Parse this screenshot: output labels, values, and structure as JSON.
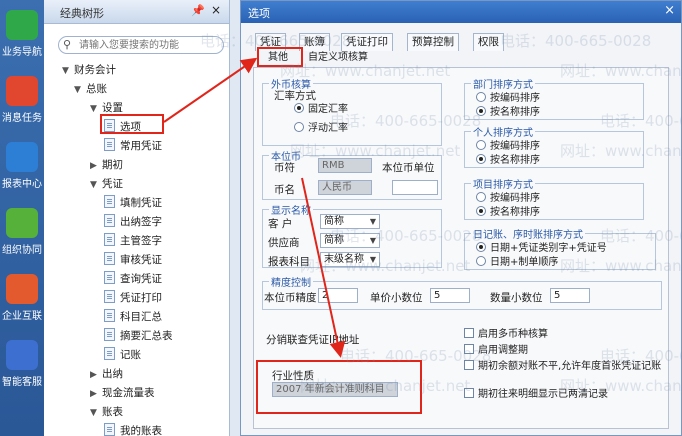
{
  "rail": [
    {
      "label": "业务导航",
      "icon": "business-nav-icon",
      "color": "#2fa84a"
    },
    {
      "label": "消息任务",
      "icon": "message-task-icon",
      "color": "#e1462f"
    },
    {
      "label": "报表中心",
      "icon": "report-center-icon",
      "color": "#2d7fd6"
    },
    {
      "label": "组织协同",
      "icon": "org-collab-icon",
      "color": "#55b13a"
    },
    {
      "label": "企业互联",
      "icon": "enterprise-link-icon",
      "color": "#e35a2e"
    },
    {
      "label": "智能客服",
      "icon": "smart-service-icon",
      "color": "#3d6fd1"
    }
  ],
  "tree": {
    "title": "经典树形",
    "pin": "📌",
    "close": "×",
    "search_placeholder": "请输入您要搜索的功能",
    "nodes": [
      {
        "label": "财务会计",
        "arrow": "▼",
        "type": "folder"
      },
      {
        "label": "总账",
        "arrow": "▼",
        "type": "folder"
      },
      {
        "label": "设置",
        "arrow": "▼",
        "type": "folder"
      },
      {
        "label": "选项",
        "arrow": "",
        "type": "doc"
      },
      {
        "label": "常用凭证",
        "arrow": "",
        "type": "doc"
      },
      {
        "label": "期初",
        "arrow": "▶",
        "type": "folder"
      },
      {
        "label": "凭证",
        "arrow": "▼",
        "type": "folder"
      },
      {
        "label": "填制凭证",
        "arrow": "",
        "type": "doc"
      },
      {
        "label": "出纳签字",
        "arrow": "",
        "type": "doc"
      },
      {
        "label": "主管签字",
        "arrow": "",
        "type": "doc"
      },
      {
        "label": "审核凭证",
        "arrow": "",
        "type": "doc"
      },
      {
        "label": "查询凭证",
        "arrow": "",
        "type": "doc"
      },
      {
        "label": "凭证打印",
        "arrow": "",
        "type": "doc"
      },
      {
        "label": "科目汇总",
        "arrow": "",
        "type": "doc"
      },
      {
        "label": "摘要汇总表",
        "arrow": "",
        "type": "doc"
      },
      {
        "label": "记账",
        "arrow": "",
        "type": "doc"
      },
      {
        "label": "出纳",
        "arrow": "▶",
        "type": "folder"
      },
      {
        "label": "现金流量表",
        "arrow": "▶",
        "type": "folder"
      },
      {
        "label": "账表",
        "arrow": "▼",
        "type": "folder"
      },
      {
        "label": "我的账表",
        "arrow": "",
        "type": "doc"
      }
    ]
  },
  "dialog": {
    "title": "选项",
    "close": "×",
    "tabs_row1": [
      "凭证",
      "账簿",
      "凭证打印",
      "预算控制",
      "权限"
    ],
    "tabs_row2": [
      "其他",
      "自定义项核算"
    ],
    "foreign": {
      "legend": "外币核算",
      "rate_label": "汇率方式",
      "options": [
        "固定汇率",
        "浮动汇率"
      ],
      "selected": 0
    },
    "base_currency": {
      "legend": "本位币",
      "code_label": "币符",
      "code_value": "RMB",
      "unit_label": "本位币单位",
      "unit_value": "",
      "name_label": "币名",
      "name_value": "人民币"
    },
    "display": {
      "legend": "显示名称",
      "rows": [
        {
          "label": "客  户",
          "value": "简称"
        },
        {
          "label": "供应商",
          "value": "简称"
        },
        {
          "label": "报表科目",
          "value": "末级名称"
        }
      ]
    },
    "precision": {
      "legend": "精度控制",
      "items": [
        {
          "label": "本位币精度",
          "value": "2"
        },
        {
          "label": "单价小数位",
          "value": "5"
        },
        {
          "label": "数量小数位",
          "value": "5"
        }
      ]
    },
    "dept_sort": {
      "legend": "部门排序方式",
      "options": [
        "按编码排序",
        "按名称排序"
      ],
      "selected": 1
    },
    "person_sort": {
      "legend": "个人排序方式",
      "options": [
        "按编码排序",
        "按名称排序"
      ],
      "selected": 1
    },
    "item_sort": {
      "legend": "项目排序方式",
      "options": [
        "按编码排序",
        "按名称排序"
      ],
      "selected": 1
    },
    "journal_sort": {
      "legend": "日记账、序时账排序方式",
      "options": [
        "日期+凭证类别字+凭证号",
        "日期+制单顺序"
      ],
      "selected": 0
    },
    "link_label": "分销联查凭证IP地址",
    "checks": [
      "启用多币种核算",
      "启用调整期",
      "期初余额对账不平,允许年度首张凭证记账",
      "期初往来明细显示已两清记录"
    ],
    "industry": {
      "label": "行业性质",
      "value": "2007 年新会计准则科目"
    }
  },
  "watermark": {
    "phone": "电话：400-665-0028",
    "site": "网址：www.chanjet.net"
  },
  "colors": {
    "highlight": "#e0261b",
    "title_bar": "#3a76c8",
    "legend": "#2b5aa8"
  }
}
